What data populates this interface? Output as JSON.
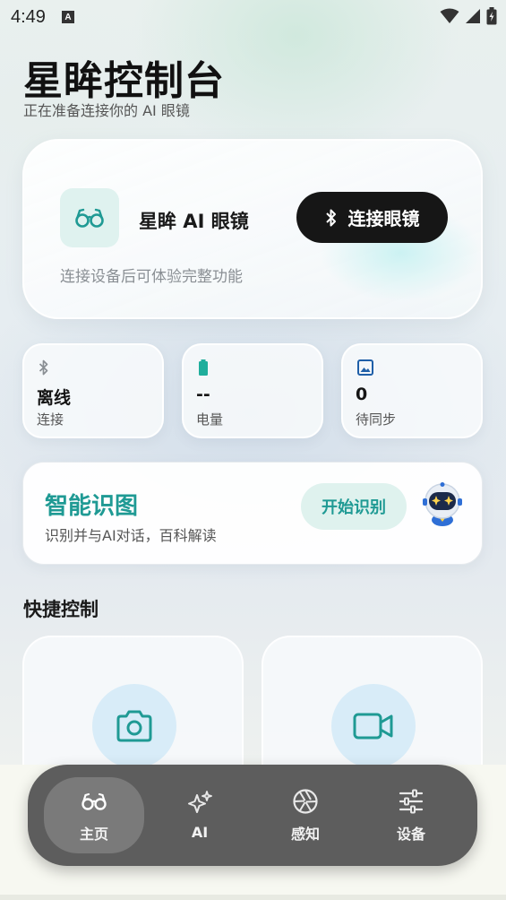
{
  "status_bar": {
    "time": "4:49",
    "notification_icon": "A"
  },
  "header": {
    "title": "星眸控制台",
    "subtitle": "正在准备连接你的 AI 眼镜"
  },
  "device_card": {
    "device_name": "星眸 AI 眼镜",
    "connect_label": "连接眼镜",
    "hint": "连接设备后可体验完整功能",
    "icon": "glasses-icon"
  },
  "stats": [
    {
      "icon": "bluetooth-icon",
      "value": "离线",
      "label": "连接"
    },
    {
      "icon": "battery-icon",
      "value": "--",
      "label": "电量"
    },
    {
      "icon": "image-icon",
      "value": "0",
      "label": "待同步"
    }
  ],
  "recognition": {
    "title": "智能识图",
    "subtitle": "识别并与AI对话，百科解读",
    "button_label": "开始识别"
  },
  "quick_controls": {
    "title": "快捷控制",
    "items": [
      {
        "icon": "camera-icon"
      },
      {
        "icon": "video-icon"
      }
    ]
  },
  "tabs": [
    {
      "label": "主页",
      "icon": "glasses-icon",
      "active": true
    },
    {
      "label": "AI",
      "icon": "sparkle-icon",
      "active": false
    },
    {
      "label": "感知",
      "icon": "aperture-icon",
      "active": false
    },
    {
      "label": "设备",
      "icon": "sliders-icon",
      "active": false
    }
  ],
  "colors": {
    "accent": "#1f9a94",
    "accent_soft": "#dff2ee",
    "button_dark": "#161616",
    "tabbar": "#5d5d5d",
    "battery": "#1fae9c",
    "image_icon": "#1f5fa8"
  }
}
